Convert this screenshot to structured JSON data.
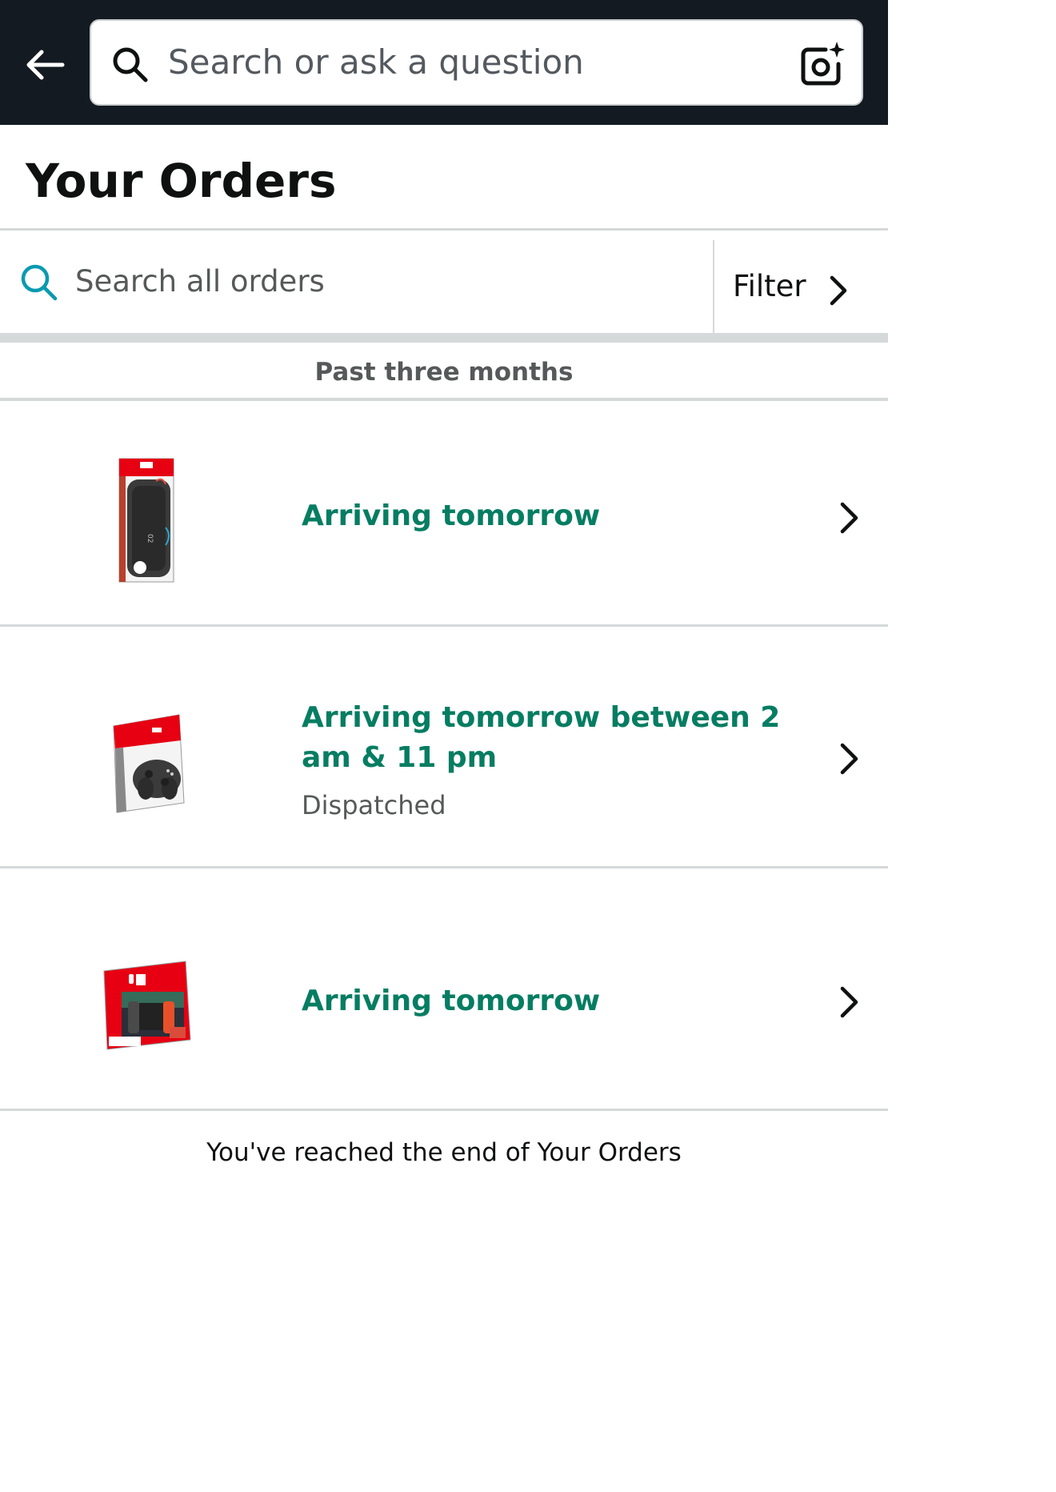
{
  "header": {
    "search_placeholder": "Search or ask a question"
  },
  "page": {
    "title": "Your Orders",
    "order_search_placeholder": "Search all orders",
    "filter_label": "Filter",
    "section_label": "Past three months",
    "end_message": "You've reached the end of Your Orders"
  },
  "orders": [
    {
      "status": "Arriving tomorrow",
      "detail": ""
    },
    {
      "status": "Arriving tomorrow between 2 am & 11 pm",
      "detail": "Dispatched"
    },
    {
      "status": "Arriving tomorrow",
      "detail": ""
    }
  ],
  "colors": {
    "header_bg": "#131a22",
    "accent_teal": "#067d62",
    "search_icon_teal": "#0a9ab0",
    "divider": "#d5d9d9",
    "nintendo_red": "#e60012"
  }
}
